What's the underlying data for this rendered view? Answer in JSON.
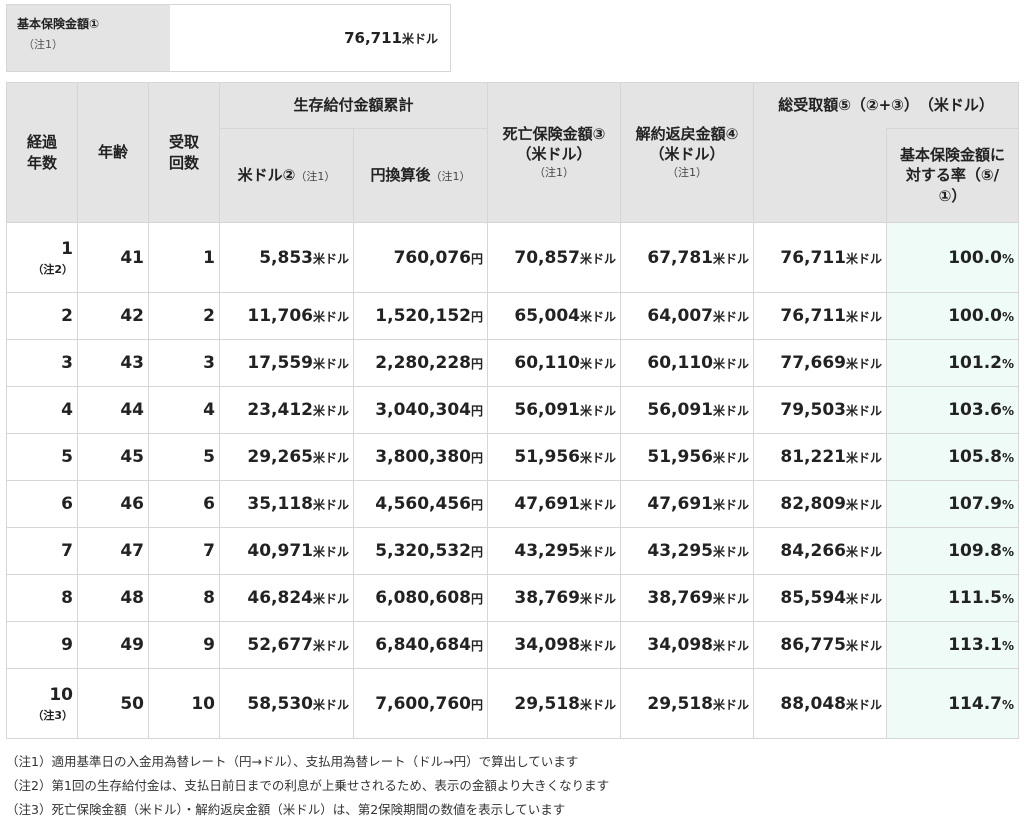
{
  "summary": {
    "label": "基本保険金額①",
    "note": "（注1）",
    "value": "76,711",
    "unit": "米ドル"
  },
  "header": {
    "years": "経過年数",
    "age": "年齢",
    "count": "受取回数",
    "survival_group": "生存給付金額累計",
    "survival_usd": "米ドル②",
    "survival_usd_note": "（注1）",
    "survival_jpy": "円換算後",
    "survival_jpy_note": "（注1）",
    "death": "死亡保険金額③",
    "death_unit": "（米ドル）",
    "death_note": "（注1）",
    "surrender": "解約返戻金額④",
    "surrender_unit": "（米ドル）",
    "surrender_note": "（注1）",
    "total": "総受取額⑤（②+③）　（米ドル）",
    "ratio": "基本保険金額に対する率（⑤/①）"
  },
  "units": {
    "usd": "米ドル",
    "jpy": "円",
    "pct": "%"
  },
  "rows": [
    {
      "year": "1",
      "year_note": "（注2）",
      "age": "41",
      "count": "1",
      "usd": "5,853",
      "jpy": "760,076",
      "death": "70,857",
      "surrender": "67,781",
      "total": "76,711",
      "ratio": "100.0"
    },
    {
      "year": "2",
      "year_note": "",
      "age": "42",
      "count": "2",
      "usd": "11,706",
      "jpy": "1,520,152",
      "death": "65,004",
      "surrender": "64,007",
      "total": "76,711",
      "ratio": "100.0"
    },
    {
      "year": "3",
      "year_note": "",
      "age": "43",
      "count": "3",
      "usd": "17,559",
      "jpy": "2,280,228",
      "death": "60,110",
      "surrender": "60,110",
      "total": "77,669",
      "ratio": "101.2"
    },
    {
      "year": "4",
      "year_note": "",
      "age": "44",
      "count": "4",
      "usd": "23,412",
      "jpy": "3,040,304",
      "death": "56,091",
      "surrender": "56,091",
      "total": "79,503",
      "ratio": "103.6"
    },
    {
      "year": "5",
      "year_note": "",
      "age": "45",
      "count": "5",
      "usd": "29,265",
      "jpy": "3,800,380",
      "death": "51,956",
      "surrender": "51,956",
      "total": "81,221",
      "ratio": "105.8"
    },
    {
      "year": "6",
      "year_note": "",
      "age": "46",
      "count": "6",
      "usd": "35,118",
      "jpy": "4,560,456",
      "death": "47,691",
      "surrender": "47,691",
      "total": "82,809",
      "ratio": "107.9"
    },
    {
      "year": "7",
      "year_note": "",
      "age": "47",
      "count": "7",
      "usd": "40,971",
      "jpy": "5,320,532",
      "death": "43,295",
      "surrender": "43,295",
      "total": "84,266",
      "ratio": "109.8"
    },
    {
      "year": "8",
      "year_note": "",
      "age": "48",
      "count": "8",
      "usd": "46,824",
      "jpy": "6,080,608",
      "death": "38,769",
      "surrender": "38,769",
      "total": "85,594",
      "ratio": "111.5"
    },
    {
      "year": "9",
      "year_note": "",
      "age": "49",
      "count": "9",
      "usd": "52,677",
      "jpy": "6,840,684",
      "death": "34,098",
      "surrender": "34,098",
      "total": "86,775",
      "ratio": "113.1"
    },
    {
      "year": "10",
      "year_note": "（注3）",
      "age": "50",
      "count": "10",
      "usd": "58,530",
      "jpy": "7,600,760",
      "death": "29,518",
      "surrender": "29,518",
      "total": "88,048",
      "ratio": "114.7"
    }
  ],
  "notes": [
    "（注1）適用基準日の入金用為替レート（円→ドル）、支払用為替レート（ドル→円）で算出しています",
    "（注2）第1回の生存給付金は、支払日前日までの利息が上乗せされるため、表示の金額より大きくなります",
    "（注3）死亡保険金額（米ドル）・解約返戻金額（米ドル）は、第2保険期間の数値を表示しています"
  ]
}
